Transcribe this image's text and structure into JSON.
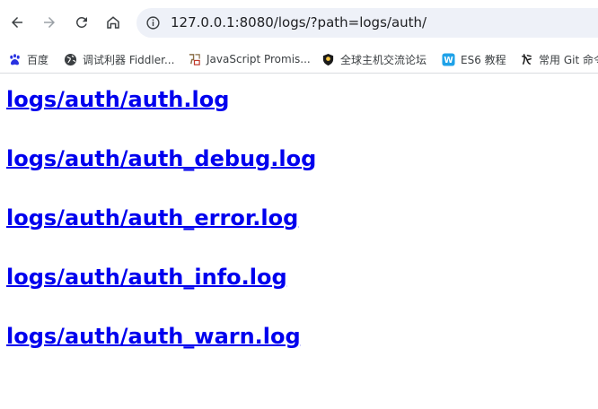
{
  "browser": {
    "url": "127.0.0.1:8080/logs/?path=logs/auth/",
    "nav": {
      "back_icon": "back-arrow-icon",
      "forward_icon": "forward-arrow-icon",
      "reload_icon": "reload-icon",
      "home_icon": "home-icon"
    }
  },
  "bookmarks": [
    {
      "label": "百度",
      "icon": "baidu-paw-icon",
      "color": "#2932e1"
    },
    {
      "label": "调试利器 Fiddler...",
      "icon": "globe-icon",
      "color": "#3c4043"
    },
    {
      "label": "JavaScript Promis...",
      "icon": "js-icon",
      "color": "#8b6f47"
    },
    {
      "label": "全球主机交流论坛",
      "icon": "hostloc-icon",
      "color": "#1a1a1a"
    },
    {
      "label": "ES6 教程",
      "icon": "w-logo-icon",
      "color": "#1fa2e8"
    },
    {
      "label": "常用 Git 命令",
      "icon": "git-icon",
      "color": "#1a1a1a"
    }
  ],
  "links": [
    "logs/auth/auth.log",
    "logs/auth/auth_debug.log",
    "logs/auth/auth_error.log",
    "logs/auth/auth_info.log",
    "logs/auth/auth_warn.log"
  ],
  "colors": {
    "link": "#0000ee",
    "omnibox": "#eef1f8"
  }
}
